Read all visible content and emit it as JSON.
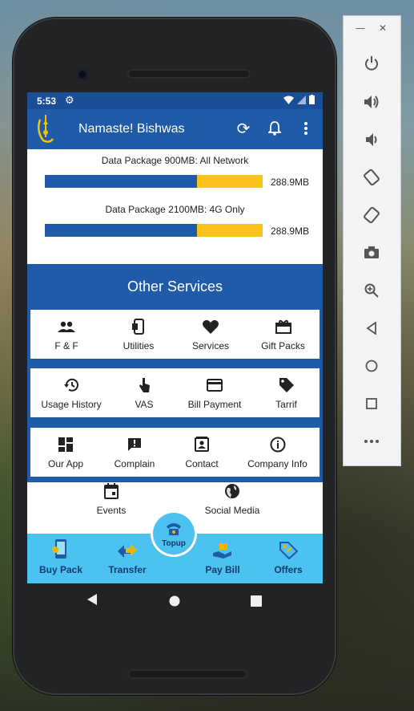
{
  "status_bar": {
    "time": "5:53"
  },
  "app_bar": {
    "title": "Namaste! Bishwas"
  },
  "packages": [
    {
      "label": "Data Package 900MB: All Network",
      "remaining": "288.9MB",
      "used_fraction": 0.7
    },
    {
      "label": "Data Package 2100MB: 4G Only",
      "remaining": "288.9MB",
      "used_fraction": 0.7
    }
  ],
  "services": {
    "heading": "Other Services",
    "rows": [
      [
        {
          "label": "F & F",
          "icon": "people-icon"
        },
        {
          "label": "Utilities",
          "icon": "phone-utilities-icon"
        },
        {
          "label": "Services",
          "icon": "heart-icon"
        },
        {
          "label": "Gift Packs",
          "icon": "gift-icon"
        }
      ],
      [
        {
          "label": "Usage History",
          "icon": "history-icon"
        },
        {
          "label": "VAS",
          "icon": "touch-icon"
        },
        {
          "label": "Bill Payment",
          "icon": "card-icon"
        },
        {
          "label": "Tarrif",
          "icon": "tag-icon"
        }
      ],
      [
        {
          "label": "Our App",
          "icon": "dashboard-icon"
        },
        {
          "label": "Complain",
          "icon": "feedback-icon"
        },
        {
          "label": "Contact",
          "icon": "contact-icon"
        },
        {
          "label": "Company Info",
          "icon": "info-icon"
        }
      ]
    ],
    "extra": [
      {
        "label": "Events",
        "icon": "calendar-icon"
      },
      {
        "label": "Social Media",
        "icon": "globe-icon"
      }
    ]
  },
  "bottom_nav": {
    "items": [
      {
        "label": "Buy Pack",
        "icon": "buy-pack-icon"
      },
      {
        "label": "Transfer",
        "icon": "transfer-icon"
      },
      {
        "label": "Pay Bill",
        "icon": "pay-bill-icon"
      },
      {
        "label": "Offers",
        "icon": "offers-icon"
      }
    ],
    "center": {
      "label": "Topup",
      "icon": "topup-icon"
    }
  },
  "colors": {
    "primary": "#1f5ba8",
    "accent": "#fbc21a",
    "nav": "#4cc2f0"
  }
}
